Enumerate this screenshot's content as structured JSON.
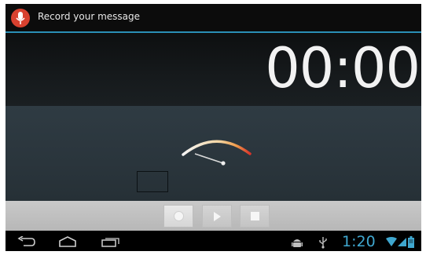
{
  "window": {
    "title": "Record your message",
    "app_icon": "microphone-icon"
  },
  "recorder": {
    "elapsed": "00:00",
    "level_meter": "level-gauge",
    "controls": {
      "record": "record-icon",
      "play": "play-icon",
      "stop": "stop-icon"
    }
  },
  "system_bar": {
    "nav": [
      "back-icon",
      "home-icon",
      "recent-apps-icon"
    ],
    "notifications": [
      "android-debug-icon",
      "usb-icon"
    ],
    "clock": "1:20",
    "status": [
      "wifi-icon",
      "signal-icon",
      "battery-icon"
    ]
  },
  "colors": {
    "accent": "#2a8fb7",
    "clock": "#3fa7cf",
    "app_icon": "#d8412f"
  }
}
